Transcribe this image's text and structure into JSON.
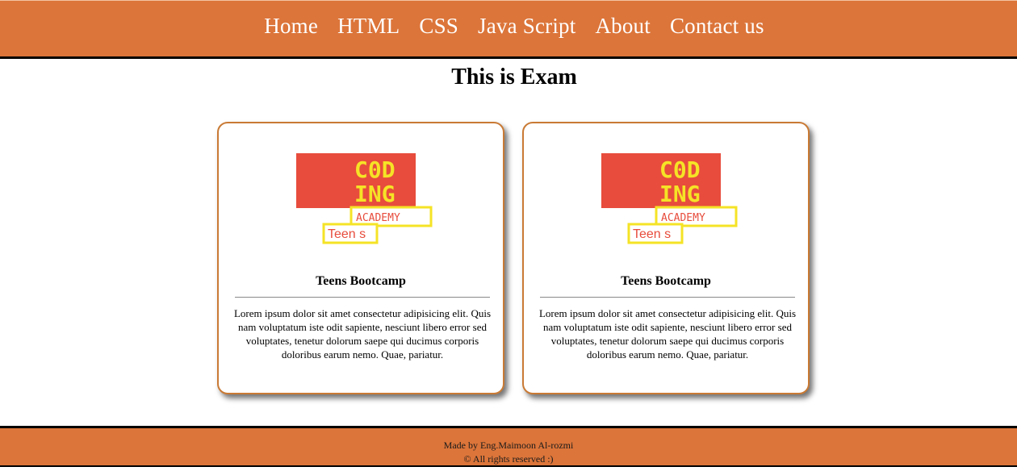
{
  "nav": {
    "items": [
      {
        "label": "Home"
      },
      {
        "label": "HTML"
      },
      {
        "label": "CSS"
      },
      {
        "label": "Java Script"
      },
      {
        "label": "About"
      },
      {
        "label": "Contact us"
      }
    ]
  },
  "page": {
    "title": "This is Exam"
  },
  "cards": [
    {
      "logo": {
        "line1": "C0D",
        "line2": "ING",
        "line3": "ACADEMY",
        "line4": "Teen s"
      },
      "title": "Teens Bootcamp",
      "text": "Lorem ipsum dolor sit amet consectetur adipisicing elit. Quis nam voluptatum iste odit sapiente, nesciunt libero error sed voluptates, tenetur dolorum saepe qui ducimus corporis doloribus earum nemo. Quae, pariatur."
    },
    {
      "logo": {
        "line1": "C0D",
        "line2": "ING",
        "line3": "ACADEMY",
        "line4": "Teen s"
      },
      "title": "Teens Bootcamp",
      "text": "Lorem ipsum dolor sit amet consectetur adipisicing elit. Quis nam voluptatum iste odit sapiente, nesciunt libero error sed voluptates, tenetur dolorum saepe qui ducimus corporis doloribus earum nemo. Quae, pariatur."
    }
  ],
  "footer": {
    "line1": "Made by Eng.Maimoon Al-rozmi",
    "line2": "© All rights reserved :)"
  },
  "colors": {
    "nav_bg": "#dc753a",
    "logo_red": "#e74c3c",
    "logo_yellow": "#f5e326"
  }
}
